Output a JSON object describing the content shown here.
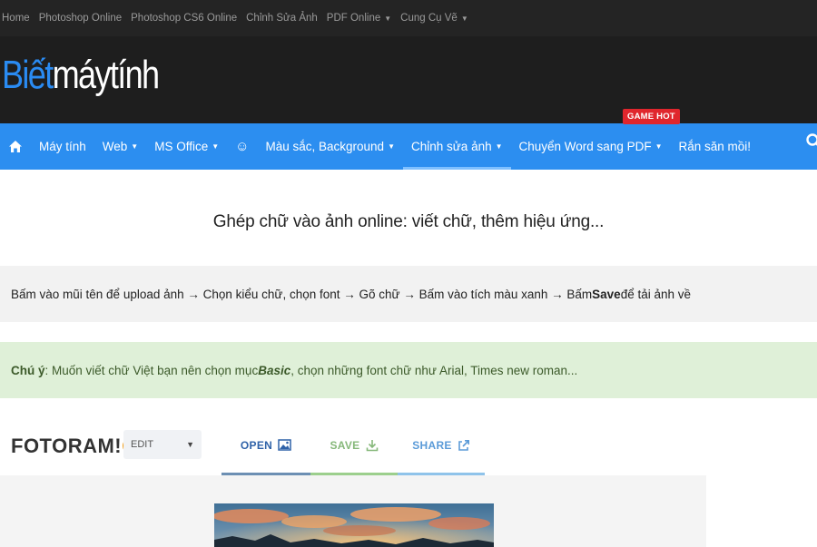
{
  "topbar": {
    "links": [
      {
        "label": "Home",
        "dropdown": false
      },
      {
        "label": "Photoshop Online",
        "dropdown": false
      },
      {
        "label": "Photoshop CS6 Online",
        "dropdown": false
      },
      {
        "label": "Chỉnh Sửa Ảnh",
        "dropdown": false
      },
      {
        "label": "PDF Online",
        "dropdown": true
      },
      {
        "label": "Cung Cụ Vẽ",
        "dropdown": true
      }
    ]
  },
  "logo": {
    "part1": "Biết",
    "part2": "máytính"
  },
  "nav": {
    "home_icon": "home-icon",
    "items": [
      {
        "label": "Máy tính",
        "dropdown": false
      },
      {
        "label": "Web",
        "dropdown": true
      },
      {
        "label": "MS Office",
        "dropdown": true
      },
      {
        "label": "☺",
        "dropdown": false
      },
      {
        "label": "Màu sắc, Background",
        "dropdown": true
      },
      {
        "label": "Chỉnh sửa ảnh",
        "dropdown": true
      },
      {
        "label": "Chuyển Word sang PDF",
        "dropdown": true
      },
      {
        "label": "Rắn săn mồi!",
        "dropdown": false
      }
    ],
    "badge": "GAME HOT",
    "search_icon": "search-icon"
  },
  "title": "Ghép chữ vào ảnh online: viết chữ, thêm hiệu ứng...",
  "instructions": {
    "before": "Bấm vào mũi tên để upload ảnh → Chọn kiểu chữ, chọn font → Gõ chữ → Bấm vào tích màu xanh → Bấm ",
    "bold": "Save",
    "after": " để tải ảnh về"
  },
  "note": {
    "label": "Chú ý",
    "text1": ": Muốn viết chữ Việt bạn nên chọn mục ",
    "emph": "Basic",
    "text2": ", chọn những font chữ như Arial, Times new roman..."
  },
  "editor": {
    "brand": "FOTORAM!",
    "mode_value": "EDIT",
    "tabs": [
      {
        "label": "OPEN",
        "icon": "image-icon"
      },
      {
        "label": "SAVE",
        "icon": "download-icon"
      },
      {
        "label": "SHARE",
        "icon": "share-icon"
      }
    ]
  },
  "colors": {
    "topbar_bg": "#242424",
    "header_bg": "#1e1e1e",
    "nav_bg": "#2c8ef0",
    "logo_accent": "#2a8bf2",
    "badge_bg": "#e0262d",
    "note_bg": "#dff0d8"
  }
}
